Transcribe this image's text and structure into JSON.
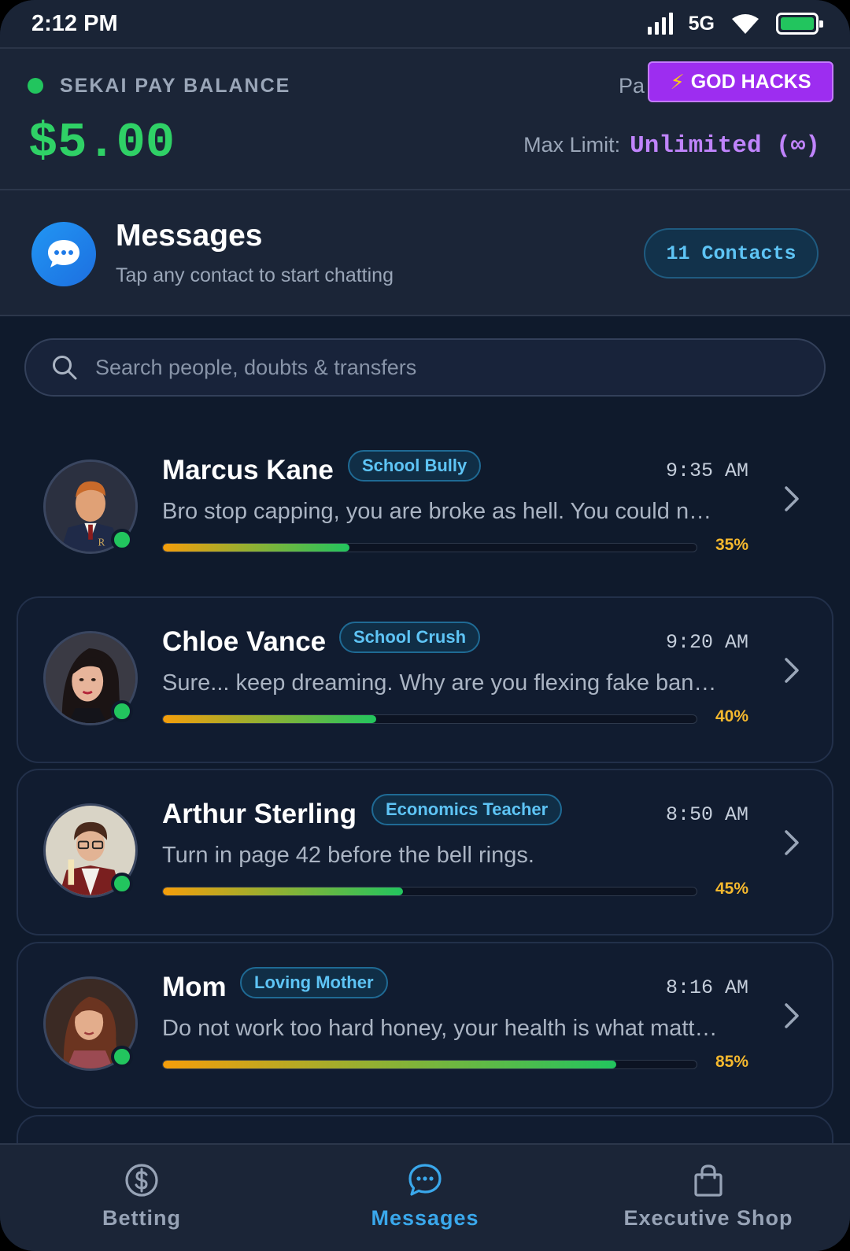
{
  "status_bar": {
    "time": "2:12 PM",
    "network": "5G"
  },
  "balance": {
    "label": "SEKAI PAY BALANCE",
    "amount": "$5.00",
    "pa_text": "Pa",
    "hacks_button": "GOD HACKS",
    "max_limit_label": "Max Limit:",
    "max_limit_value": "Unlimited (∞)"
  },
  "messages_header": {
    "title": "Messages",
    "subtitle": "Tap any contact to start chatting",
    "contacts_badge": "11 Contacts"
  },
  "search": {
    "placeholder": "Search people, doubts & transfers"
  },
  "contacts": [
    {
      "name": "Marcus Kane",
      "role": "School Bully",
      "time": "9:35 AM",
      "preview": "Bro stop capping, you are broke as hell. You could n…",
      "progress": 35,
      "progress_label": "35%"
    },
    {
      "name": "Chloe Vance",
      "role": "School Crush",
      "time": "9:20 AM",
      "preview": "Sure... keep dreaming. Why are you flexing fake ban…",
      "progress": 40,
      "progress_label": "40%"
    },
    {
      "name": "Arthur Sterling",
      "role": "Economics Teacher",
      "time": "8:50 AM",
      "preview": "Turn in page 42 before the bell rings.",
      "progress": 45,
      "progress_label": "45%"
    },
    {
      "name": "Mom",
      "role": "Loving Mother",
      "time": "8:16 AM",
      "preview": "Do not work too hard honey, your health is what matt…",
      "progress": 85,
      "progress_label": "85%"
    }
  ],
  "nav": [
    {
      "label": "Betting",
      "icon": "dollar-circle-icon",
      "active": false
    },
    {
      "label": "Messages",
      "icon": "chat-bubble-icon",
      "active": true
    },
    {
      "label": "Executive Shop",
      "icon": "shopping-bag-icon",
      "active": false
    }
  ],
  "colors": {
    "background": "#0f1a2c",
    "panel": "#1b2537",
    "balance_green": "#2fd166",
    "accent_blue": "#3aa8ec",
    "hacks_purple": "#9d2df0",
    "unlimited_purple": "#c084fc",
    "progress_start": "#f59e0b",
    "progress_end": "#22c55e"
  }
}
